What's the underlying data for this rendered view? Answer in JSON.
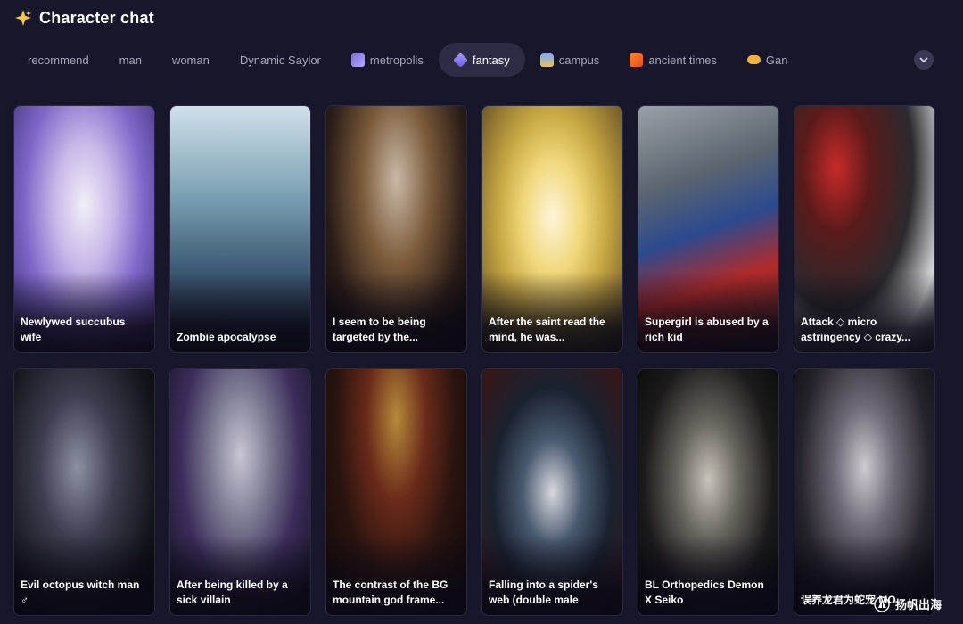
{
  "header": {
    "title": "Character chat",
    "icon": "sparkle-icon"
  },
  "tabs": [
    {
      "label": "recommend",
      "icon": ""
    },
    {
      "label": "man",
      "icon": ""
    },
    {
      "label": "woman",
      "icon": ""
    },
    {
      "label": "Dynamic Saylor",
      "icon": ""
    },
    {
      "label": "metropolis",
      "icon": "city-icon"
    },
    {
      "label": "fantasy",
      "icon": "crystal-icon",
      "active": true
    },
    {
      "label": "campus",
      "icon": "backpack-icon"
    },
    {
      "label": "ancient times",
      "icon": "scroll-icon"
    },
    {
      "label": "Gan",
      "icon": "gamepad-icon"
    }
  ],
  "cards": [
    {
      "title": "Newlywed succubus wife"
    },
    {
      "title": "Zombie apocalypse"
    },
    {
      "title": "I seem to be being targeted by the..."
    },
    {
      "title": "After the saint read the mind, he was..."
    },
    {
      "title": "Supergirl is abused by a rich kid"
    },
    {
      "title": "Attack ◇ micro astringency ◇ crazy..."
    },
    {
      "title": "Evil octopus witch man ♂"
    },
    {
      "title": "After being killed by a sick villain"
    },
    {
      "title": "The contrast of the BG mountain god frame..."
    },
    {
      "title": "Falling into a spider's web (double male"
    },
    {
      "title": "BL Orthopedics Demon X Seiko"
    },
    {
      "title": "误养龙君为蛇宠 MO"
    }
  ],
  "watermark": {
    "text": "扬帆出海"
  },
  "colors": {
    "background": "#17162a",
    "active_tab": "#2d2c45",
    "muted_text": "#a8a6bd"
  }
}
